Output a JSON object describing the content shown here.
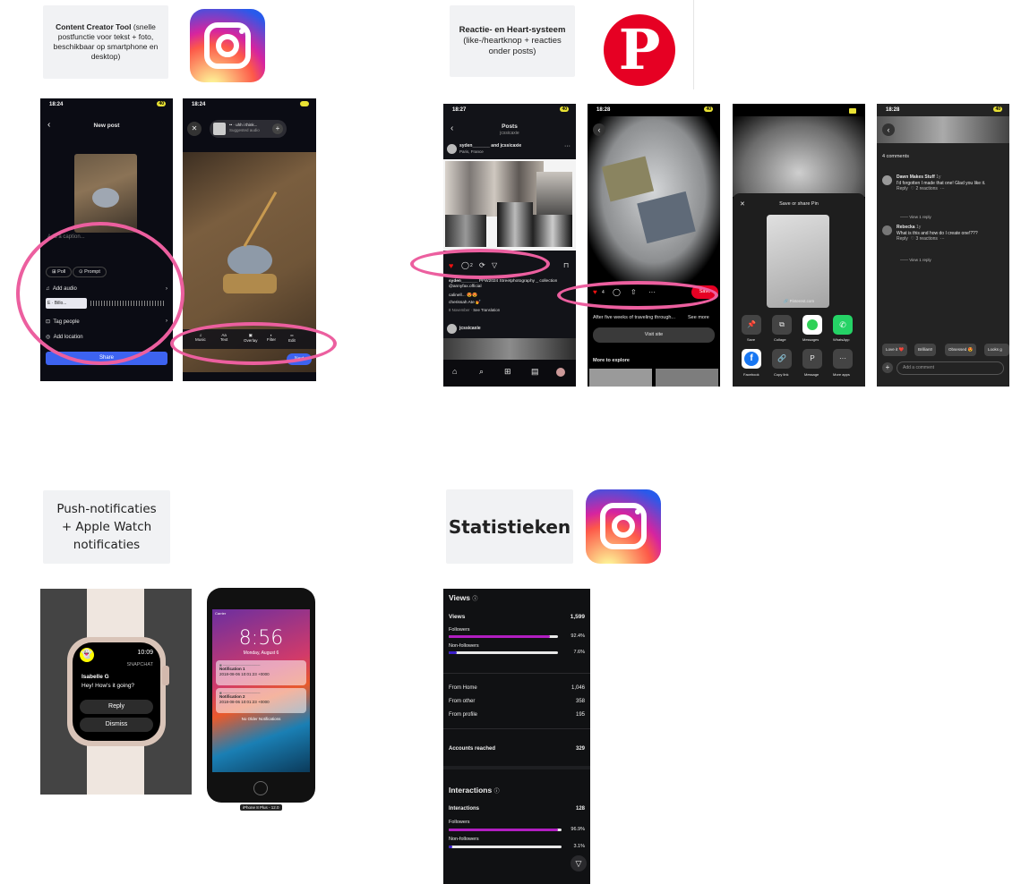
{
  "sections": {
    "creator": {
      "title": "Content Creator Tool",
      "desc": "(snelle postfunctie voor tekst + foto, beschikbaar op smartphone en desktop)"
    },
    "reactions": {
      "title": "Reactie- en Heart-systeem",
      "desc": "(like-/heartknop + reacties onder posts)"
    },
    "push": {
      "title": "Push-notificaties + Apple Watch notificaties"
    },
    "stats": {
      "title": "Statistieken"
    }
  },
  "phone_newpost": {
    "time": "18:24",
    "battery": "40",
    "header": "New post",
    "caption_placeholder": "Add a caption...",
    "chips": [
      "Poll",
      "Prompt"
    ],
    "add_audio": "Add audio",
    "audio_track": "E · Billo...",
    "tag_people": "Tag people",
    "add_location": "Add location",
    "share": "Share"
  },
  "phone_editor": {
    "time": "18:24",
    "audio_title": "•• · uhh i think...",
    "audio_sub": "Suggested audio",
    "tools": [
      "Music",
      "Text",
      "Overlay",
      "Filter",
      "Edit"
    ],
    "next": "Next"
  },
  "phone_posts": {
    "time": "18:27",
    "header": "Posts",
    "sub": "jcssicaxie",
    "user": "syden_______ and jcssicaxie",
    "location": "Paris, France",
    "comments_count": "2",
    "caption_user": "syden_______",
    "caption_text": "PFW2024 Streetphotography _ collection @annyfax.official",
    "comment1": "calinell... 😍😍",
    "comment2": "cherissah Ate 💅",
    "date": "8 November",
    "see_translation": "See Translation",
    "next_user": "jcssicaxie"
  },
  "phone_pin": {
    "time": "18:28",
    "like_count": "4",
    "save": "Save",
    "desc": "After five weeks of traveling through...",
    "see_more": "See more",
    "visit": "Visit site",
    "more": "More to explore"
  },
  "phone_share": {
    "title": "Save or share Pin",
    "url": "🔗 Pinterest.com",
    "row1": [
      "Save",
      "Collage",
      "Messages",
      "WhatsApp"
    ],
    "row2": [
      "Facebook",
      "Copy link",
      "Message",
      "More apps"
    ]
  },
  "phone_comments": {
    "time": "18:28",
    "count": "4 comments",
    "c1_user": "Dawn Makes Stuff",
    "c1_time": "1y",
    "c1_text": "I'd forgotten I made that one! Glad you like it.",
    "c1_reply": "Reply",
    "c1_reactions": "2 reactions",
    "view_reply": "View 1 reply",
    "c2_user": "Rebecka",
    "c2_time": "1y",
    "c2_text": "What is this and how do I create one!???",
    "c2_reply": "Reply",
    "c2_reactions": "3 reactions",
    "view_reply2": "View 1 reply",
    "quick": [
      "Love it ❤️",
      "Brilliant!",
      "Obsessed 😍",
      "Looks g"
    ],
    "add_comment": "Add a comment"
  },
  "watch": {
    "time": "10:09",
    "app": "SNAPCHAT",
    "sender": "Isabelle G",
    "message": "Hey! How's it going?",
    "reply": "Reply",
    "dismiss": "Dismiss"
  },
  "iphone": {
    "carrier": "Carrier",
    "time": "8:56",
    "date": "Monday, August 6",
    "n1_title": "Notification 1",
    "n1_time": "2018-08-06 10:01:23 +0000",
    "n2_title": "Notification 2",
    "n2_time": "2018-08-06 10:01:23 +0000",
    "no_older": "No Older Notifications",
    "device": "iPhone 8 Plus - 12.0"
  },
  "insights": {
    "views_header": "Views",
    "views_label": "Views",
    "views_value": "1,599",
    "followers_label": "Followers",
    "followers_pct": "92.4%",
    "followers_frac": 0.924,
    "nonfollowers_label": "Non-followers",
    "nonfollowers_pct": "7.6%",
    "nonfollowers_frac": 0.076,
    "from_home": "From Home",
    "from_home_v": "1,046",
    "from_other": "From other",
    "from_other_v": "358",
    "from_profile": "From profile",
    "from_profile_v": "195",
    "accounts": "Accounts reached",
    "accounts_v": "329",
    "inter_header": "Interactions",
    "inter_label": "Interactions",
    "inter_value": "128",
    "i_followers": "Followers",
    "i_followers_pct": "96.9%",
    "i_followers_frac": 0.969,
    "i_nonfollowers": "Non-followers",
    "i_nonfollowers_pct": "3.1%",
    "i_nonfollowers_frac": 0.031
  },
  "colors": {
    "highlight": "#ec5f9f",
    "pinterest": "#e60023",
    "accent_purple": "#b11ec1"
  }
}
